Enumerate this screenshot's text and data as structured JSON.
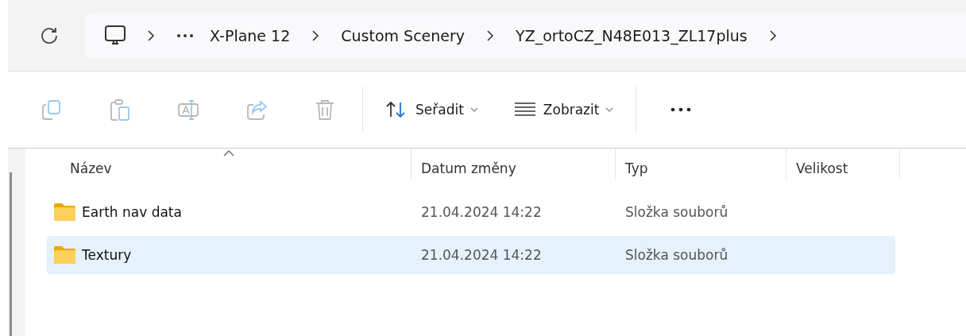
{
  "address_bar": {
    "crumbs": [
      {
        "kind": "computer"
      },
      {
        "kind": "overflow"
      },
      {
        "kind": "text",
        "label": "X-Plane 12"
      },
      {
        "kind": "text",
        "label": "Custom Scenery"
      },
      {
        "kind": "text",
        "label": "YZ_ortoCZ_N48E013_ZL17plus"
      }
    ]
  },
  "toolbar": {
    "actions": [
      {
        "kind": "copy",
        "disabled": true
      },
      {
        "kind": "paste",
        "disabled": true
      },
      {
        "kind": "rename",
        "disabled": true
      },
      {
        "kind": "share",
        "disabled": true
      },
      {
        "kind": "delete",
        "disabled": true
      }
    ],
    "menus": [
      {
        "kind": "sort",
        "label": "Seřadit"
      },
      {
        "kind": "view",
        "label": "Zobrazit"
      }
    ]
  },
  "table": {
    "columns": [
      {
        "label": "Název",
        "sorted": true
      },
      {
        "label": "Datum změny",
        "sorted": false
      },
      {
        "label": "Typ",
        "sorted": false
      },
      {
        "label": "Velikost",
        "sorted": false
      }
    ],
    "rows": [
      {
        "name": "Earth nav data",
        "modified": "21.04.2024 14:22",
        "type": "Složka souborů",
        "selected": false
      },
      {
        "name": "Textury",
        "modified": "21.04.2024 14:22",
        "type": "Složka souborů",
        "selected": true
      }
    ]
  }
}
